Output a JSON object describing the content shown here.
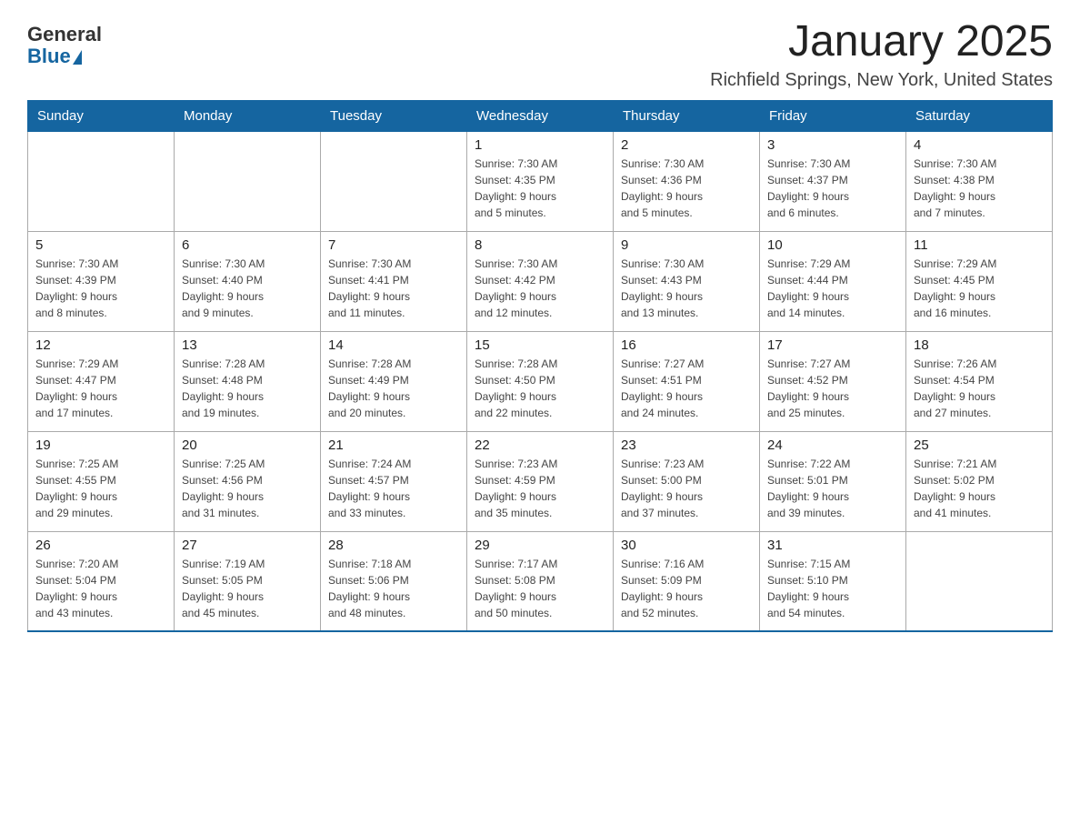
{
  "logo": {
    "general": "General",
    "blue": "Blue"
  },
  "title": "January 2025",
  "location": "Richfield Springs, New York, United States",
  "days_of_week": [
    "Sunday",
    "Monday",
    "Tuesday",
    "Wednesday",
    "Thursday",
    "Friday",
    "Saturday"
  ],
  "weeks": [
    [
      {
        "day": "",
        "info": ""
      },
      {
        "day": "",
        "info": ""
      },
      {
        "day": "",
        "info": ""
      },
      {
        "day": "1",
        "info": "Sunrise: 7:30 AM\nSunset: 4:35 PM\nDaylight: 9 hours\nand 5 minutes."
      },
      {
        "day": "2",
        "info": "Sunrise: 7:30 AM\nSunset: 4:36 PM\nDaylight: 9 hours\nand 5 minutes."
      },
      {
        "day": "3",
        "info": "Sunrise: 7:30 AM\nSunset: 4:37 PM\nDaylight: 9 hours\nand 6 minutes."
      },
      {
        "day": "4",
        "info": "Sunrise: 7:30 AM\nSunset: 4:38 PM\nDaylight: 9 hours\nand 7 minutes."
      }
    ],
    [
      {
        "day": "5",
        "info": "Sunrise: 7:30 AM\nSunset: 4:39 PM\nDaylight: 9 hours\nand 8 minutes."
      },
      {
        "day": "6",
        "info": "Sunrise: 7:30 AM\nSunset: 4:40 PM\nDaylight: 9 hours\nand 9 minutes."
      },
      {
        "day": "7",
        "info": "Sunrise: 7:30 AM\nSunset: 4:41 PM\nDaylight: 9 hours\nand 11 minutes."
      },
      {
        "day": "8",
        "info": "Sunrise: 7:30 AM\nSunset: 4:42 PM\nDaylight: 9 hours\nand 12 minutes."
      },
      {
        "day": "9",
        "info": "Sunrise: 7:30 AM\nSunset: 4:43 PM\nDaylight: 9 hours\nand 13 minutes."
      },
      {
        "day": "10",
        "info": "Sunrise: 7:29 AM\nSunset: 4:44 PM\nDaylight: 9 hours\nand 14 minutes."
      },
      {
        "day": "11",
        "info": "Sunrise: 7:29 AM\nSunset: 4:45 PM\nDaylight: 9 hours\nand 16 minutes."
      }
    ],
    [
      {
        "day": "12",
        "info": "Sunrise: 7:29 AM\nSunset: 4:47 PM\nDaylight: 9 hours\nand 17 minutes."
      },
      {
        "day": "13",
        "info": "Sunrise: 7:28 AM\nSunset: 4:48 PM\nDaylight: 9 hours\nand 19 minutes."
      },
      {
        "day": "14",
        "info": "Sunrise: 7:28 AM\nSunset: 4:49 PM\nDaylight: 9 hours\nand 20 minutes."
      },
      {
        "day": "15",
        "info": "Sunrise: 7:28 AM\nSunset: 4:50 PM\nDaylight: 9 hours\nand 22 minutes."
      },
      {
        "day": "16",
        "info": "Sunrise: 7:27 AM\nSunset: 4:51 PM\nDaylight: 9 hours\nand 24 minutes."
      },
      {
        "day": "17",
        "info": "Sunrise: 7:27 AM\nSunset: 4:52 PM\nDaylight: 9 hours\nand 25 minutes."
      },
      {
        "day": "18",
        "info": "Sunrise: 7:26 AM\nSunset: 4:54 PM\nDaylight: 9 hours\nand 27 minutes."
      }
    ],
    [
      {
        "day": "19",
        "info": "Sunrise: 7:25 AM\nSunset: 4:55 PM\nDaylight: 9 hours\nand 29 minutes."
      },
      {
        "day": "20",
        "info": "Sunrise: 7:25 AM\nSunset: 4:56 PM\nDaylight: 9 hours\nand 31 minutes."
      },
      {
        "day": "21",
        "info": "Sunrise: 7:24 AM\nSunset: 4:57 PM\nDaylight: 9 hours\nand 33 minutes."
      },
      {
        "day": "22",
        "info": "Sunrise: 7:23 AM\nSunset: 4:59 PM\nDaylight: 9 hours\nand 35 minutes."
      },
      {
        "day": "23",
        "info": "Sunrise: 7:23 AM\nSunset: 5:00 PM\nDaylight: 9 hours\nand 37 minutes."
      },
      {
        "day": "24",
        "info": "Sunrise: 7:22 AM\nSunset: 5:01 PM\nDaylight: 9 hours\nand 39 minutes."
      },
      {
        "day": "25",
        "info": "Sunrise: 7:21 AM\nSunset: 5:02 PM\nDaylight: 9 hours\nand 41 minutes."
      }
    ],
    [
      {
        "day": "26",
        "info": "Sunrise: 7:20 AM\nSunset: 5:04 PM\nDaylight: 9 hours\nand 43 minutes."
      },
      {
        "day": "27",
        "info": "Sunrise: 7:19 AM\nSunset: 5:05 PM\nDaylight: 9 hours\nand 45 minutes."
      },
      {
        "day": "28",
        "info": "Sunrise: 7:18 AM\nSunset: 5:06 PM\nDaylight: 9 hours\nand 48 minutes."
      },
      {
        "day": "29",
        "info": "Sunrise: 7:17 AM\nSunset: 5:08 PM\nDaylight: 9 hours\nand 50 minutes."
      },
      {
        "day": "30",
        "info": "Sunrise: 7:16 AM\nSunset: 5:09 PM\nDaylight: 9 hours\nand 52 minutes."
      },
      {
        "day": "31",
        "info": "Sunrise: 7:15 AM\nSunset: 5:10 PM\nDaylight: 9 hours\nand 54 minutes."
      },
      {
        "day": "",
        "info": ""
      }
    ]
  ]
}
